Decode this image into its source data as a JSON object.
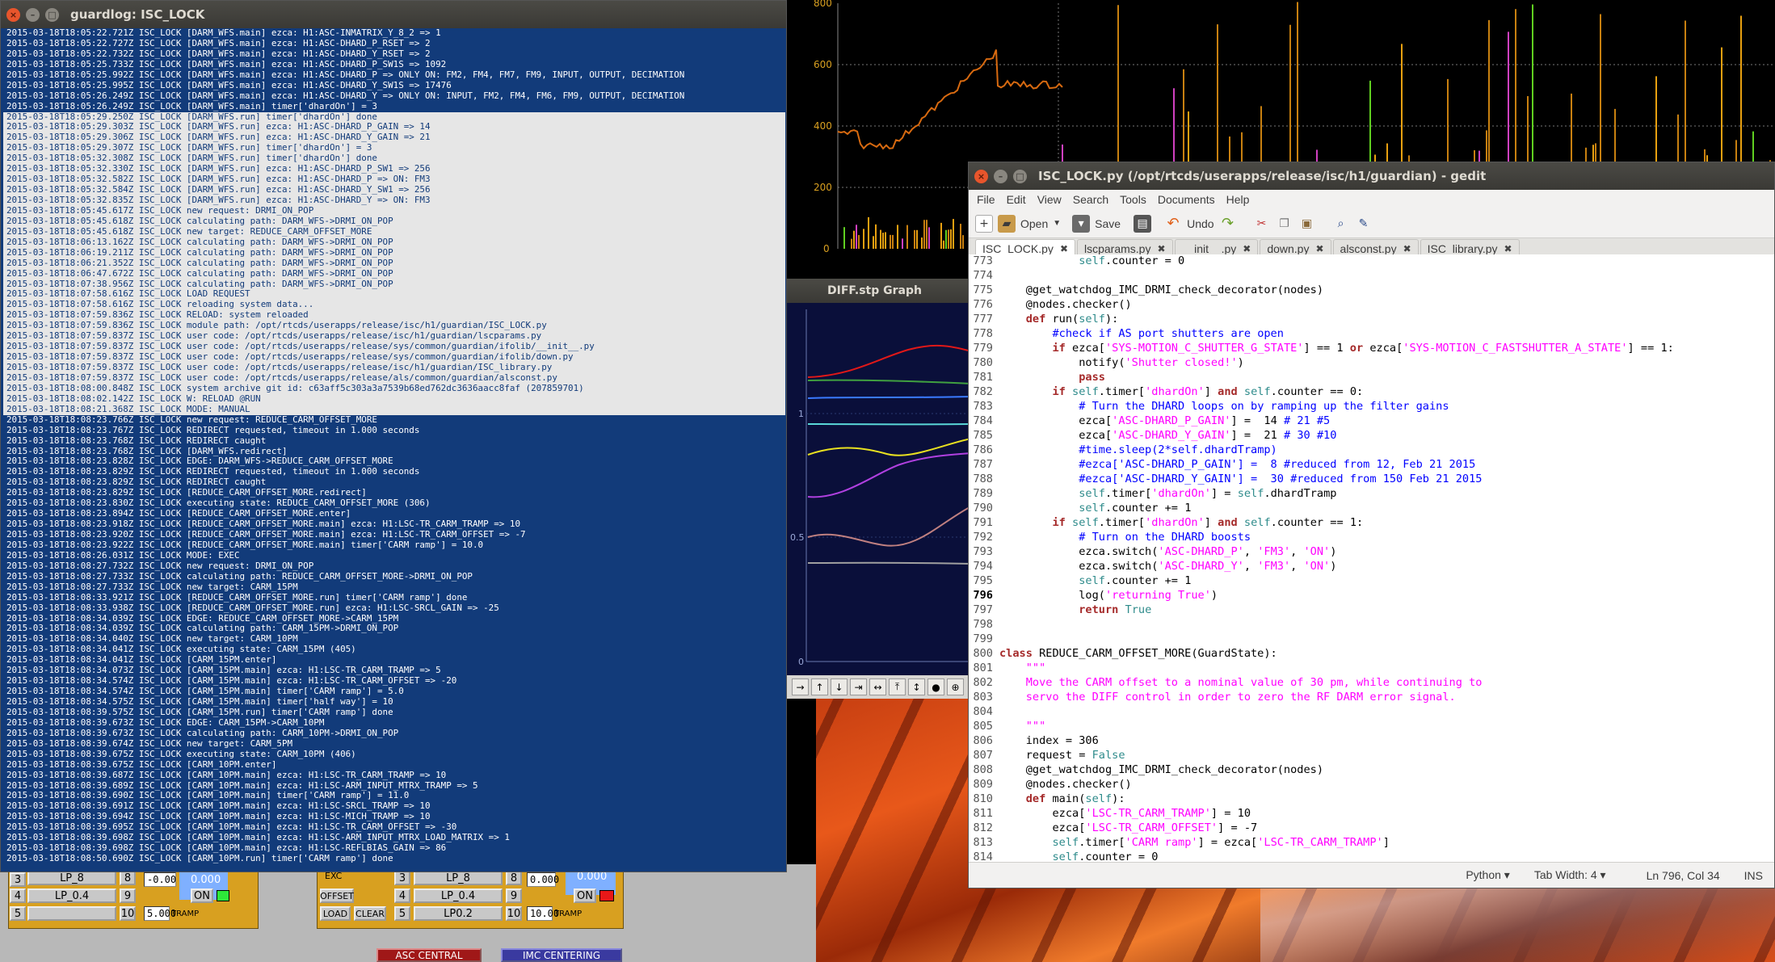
{
  "terminal": {
    "title": "guardlog: ISC_LOCK",
    "selected_from": 8,
    "selected_to": 36,
    "lines": [
      "2015-03-18T18:05:22.721Z ISC_LOCK [DARM_WFS.main] ezca: H1:ASC-INMATRIX_Y_8_2 => 1",
      "2015-03-18T18:05:22.727Z ISC_LOCK [DARM_WFS.main] ezca: H1:ASC-DHARD_P_RSET => 2",
      "2015-03-18T18:05:22.732Z ISC_LOCK [DARM_WFS.main] ezca: H1:ASC-DHARD_Y_RSET => 2",
      "2015-03-18T18:05:25.733Z ISC_LOCK [DARM_WFS.main] ezca: H1:ASC-DHARD_P_SW1S => 1092",
      "2015-03-18T18:05:25.992Z ISC_LOCK [DARM_WFS.main] ezca: H1:ASC-DHARD_P => ONLY ON: FM2, FM4, FM7, FM9, INPUT, OUTPUT, DECIMATION",
      "2015-03-18T18:05:25.995Z ISC_LOCK [DARM_WFS.main] ezca: H1:ASC-DHARD_Y_SW1S => 17476",
      "2015-03-18T18:05:26.249Z ISC_LOCK [DARM_WFS.main] ezca: H1:ASC-DHARD_Y => ONLY ON: INPUT, FM2, FM4, FM6, FM9, OUTPUT, DECIMATION",
      "2015-03-18T18:05:26.249Z ISC_LOCK [DARM_WFS.main] timer['dhardOn'] = 3",
      "2015-03-18T18:05:29.250Z ISC_LOCK [DARM_WFS.run] timer['dhardOn'] done",
      "2015-03-18T18:05:29.303Z ISC_LOCK [DARM_WFS.run] ezca: H1:ASC-DHARD_P_GAIN => 14",
      "2015-03-18T18:05:29.306Z ISC_LOCK [DARM_WFS.run] ezca: H1:ASC-DHARD_Y_GAIN => 21",
      "2015-03-18T18:05:29.307Z ISC_LOCK [DARM_WFS.run] timer['dhardOn'] = 3",
      "2015-03-18T18:05:32.308Z ISC_LOCK [DARM_WFS.run] timer['dhardOn'] done",
      "2015-03-18T18:05:32.330Z ISC_LOCK [DARM_WFS.run] ezca: H1:ASC-DHARD_P_SW1 => 256",
      "2015-03-18T18:05:32.582Z ISC_LOCK [DARM_WFS.run] ezca: H1:ASC-DHARD_P => ON: FM3",
      "2015-03-18T18:05:32.584Z ISC_LOCK [DARM_WFS.run] ezca: H1:ASC-DHARD_Y_SW1 => 256",
      "2015-03-18T18:05:32.835Z ISC_LOCK [DARM_WFS.run] ezca: H1:ASC-DHARD_Y => ON: FM3",
      "2015-03-18T18:05:45.617Z ISC_LOCK new request: DRMI_ON_POP",
      "2015-03-18T18:05:45.618Z ISC_LOCK calculating path: DARM_WFS->DRMI_ON_POP",
      "2015-03-18T18:05:45.618Z ISC_LOCK new target: REDUCE_CARM_OFFSET_MORE",
      "2015-03-18T18:06:13.162Z ISC_LOCK calculating path: DARM_WFS->DRMI_ON_POP",
      "2015-03-18T18:06:19.211Z ISC_LOCK calculating path: DARM_WFS->DRMI_ON_POP",
      "2015-03-18T18:06:21.352Z ISC_LOCK calculating path: DARM_WFS->DRMI_ON_POP",
      "2015-03-18T18:06:47.672Z ISC_LOCK calculating path: DARM_WFS->DRMI_ON_POP",
      "2015-03-18T18:07:38.956Z ISC_LOCK calculating path: DARM_WFS->DRMI_ON_POP",
      "2015-03-18T18:07:58.616Z ISC_LOCK LOAD REQUEST",
      "2015-03-18T18:07:58.616Z ISC_LOCK reloading system data...",
      "2015-03-18T18:07:59.836Z ISC_LOCK RELOAD: system reloaded",
      "2015-03-18T18:07:59.836Z ISC_LOCK module path: /opt/rtcds/userapps/release/isc/h1/guardian/ISC_LOCK.py",
      "2015-03-18T18:07:59.837Z ISC_LOCK user code: /opt/rtcds/userapps/release/isc/h1/guardian/lscparams.py",
      "2015-03-18T18:07:59.837Z ISC_LOCK user code: /opt/rtcds/userapps/release/sys/common/guardian/ifolib/__init__.py",
      "2015-03-18T18:07:59.837Z ISC_LOCK user code: /opt/rtcds/userapps/release/sys/common/guardian/ifolib/down.py",
      "2015-03-18T18:07:59.837Z ISC_LOCK user code: /opt/rtcds/userapps/release/isc/h1/guardian/ISC_library.py",
      "2015-03-18T18:07:59.837Z ISC_LOCK user code: /opt/rtcds/userapps/release/als/common/guardian/alsconst.py",
      "2015-03-18T18:08:00.848Z ISC_LOCK system archive git id: c63aff5c303a3a7539b68ed762dc3636aacc8faf (207859701)",
      "2015-03-18T18:08:02.142Z ISC_LOCK W: RELOAD @RUN",
      "2015-03-18T18:08:21.368Z ISC_LOCK MODE: MANUAL",
      "2015-03-18T18:08:23.766Z ISC_LOCK new request: REDUCE_CARM_OFFSET_MORE",
      "2015-03-18T18:08:23.767Z ISC_LOCK REDIRECT requested, timeout in 1.000 seconds",
      "2015-03-18T18:08:23.768Z ISC_LOCK REDIRECT caught",
      "2015-03-18T18:08:23.768Z ISC_LOCK [DARM_WFS.redirect]",
      "2015-03-18T18:08:23.828Z ISC_LOCK EDGE: DARM_WFS->REDUCE_CARM_OFFSET_MORE",
      "2015-03-18T18:08:23.829Z ISC_LOCK REDIRECT requested, timeout in 1.000 seconds",
      "2015-03-18T18:08:23.829Z ISC_LOCK REDIRECT caught",
      "2015-03-18T18:08:23.829Z ISC_LOCK [REDUCE_CARM_OFFSET_MORE.redirect]",
      "2015-03-18T18:08:23.830Z ISC_LOCK executing state: REDUCE_CARM_OFFSET_MORE (306)",
      "2015-03-18T18:08:23.894Z ISC_LOCK [REDUCE_CARM_OFFSET_MORE.enter]",
      "2015-03-18T18:08:23.918Z ISC_LOCK [REDUCE_CARM_OFFSET_MORE.main] ezca: H1:LSC-TR_CARM_TRAMP => 10",
      "2015-03-18T18:08:23.920Z ISC_LOCK [REDUCE_CARM_OFFSET_MORE.main] ezca: H1:LSC-TR_CARM_OFFSET => -7",
      "2015-03-18T18:08:23.922Z ISC_LOCK [REDUCE_CARM_OFFSET_MORE.main] timer['CARM ramp'] = 10.0",
      "2015-03-18T18:08:26.031Z ISC_LOCK MODE: EXEC",
      "2015-03-18T18:08:27.732Z ISC_LOCK new request: DRMI_ON_POP",
      "2015-03-18T18:08:27.733Z ISC_LOCK calculating path: REDUCE_CARM_OFFSET_MORE->DRMI_ON_POP",
      "2015-03-18T18:08:27.733Z ISC_LOCK new target: CARM_15PM",
      "2015-03-18T18:08:33.921Z ISC_LOCK [REDUCE_CARM_OFFSET_MORE.run] timer['CARM ramp'] done",
      "2015-03-18T18:08:33.938Z ISC_LOCK [REDUCE_CARM_OFFSET_MORE.run] ezca: H1:LSC-SRCL_GAIN => -25",
      "2015-03-18T18:08:34.039Z ISC_LOCK EDGE: REDUCE_CARM_OFFSET_MORE->CARM_15PM",
      "2015-03-18T18:08:34.039Z ISC_LOCK calculating path: CARM_15PM->DRMI_ON_POP",
      "2015-03-18T18:08:34.040Z ISC_LOCK new target: CARM_10PM",
      "2015-03-18T18:08:34.041Z ISC_LOCK executing state: CARM_15PM (405)",
      "2015-03-18T18:08:34.041Z ISC_LOCK [CARM_15PM.enter]",
      "2015-03-18T18:08:34.073Z ISC_LOCK [CARM_15PM.main] ezca: H1:LSC-TR_CARM_TRAMP => 5",
      "2015-03-18T18:08:34.574Z ISC_LOCK [CARM_15PM.main] ezca: H1:LSC-TR_CARM_OFFSET => -20",
      "2015-03-18T18:08:34.574Z ISC_LOCK [CARM_15PM.main] timer['CARM ramp'] = 5.0",
      "2015-03-18T18:08:34.575Z ISC_LOCK [CARM_15PM.main] timer['half way'] = 10",
      "2015-03-18T18:08:39.575Z ISC_LOCK [CARM_15PM.run] timer['CARM ramp'] done",
      "2015-03-18T18:08:39.673Z ISC_LOCK EDGE: CARM_15PM->CARM_10PM",
      "2015-03-18T18:08:39.673Z ISC_LOCK calculating path: CARM_10PM->DRMI_ON_POP",
      "2015-03-18T18:08:39.674Z ISC_LOCK new target: CARM_5PM",
      "2015-03-18T18:08:39.675Z ISC_LOCK executing state: CARM_10PM (406)",
      "2015-03-18T18:08:39.675Z ISC_LOCK [CARM_10PM.enter]",
      "2015-03-18T18:08:39.687Z ISC_LOCK [CARM_10PM.main] ezca: H1:LSC-TR_CARM_TRAMP => 10",
      "2015-03-18T18:08:39.689Z ISC_LOCK [CARM_10PM.main] ezca: H1:LSC-ARM_INPUT_MTRX_TRAMP => 5",
      "2015-03-18T18:08:39.690Z ISC_LOCK [CARM_10PM.main] timer['CARM ramp'] = 11.0",
      "2015-03-18T18:08:39.691Z ISC_LOCK [CARM_10PM.main] ezca: H1:LSC-SRCL_TRAMP => 10",
      "2015-03-18T18:08:39.694Z ISC_LOCK [CARM_10PM.main] ezca: H1:LSC-MICH_TRAMP => 10",
      "2015-03-18T18:08:39.695Z ISC_LOCK [CARM_10PM.main] ezca: H1:LSC-TR_CARM_OFFSET => -30",
      "2015-03-18T18:08:39.698Z ISC_LOCK [CARM_10PM.main] ezca: H1:LSC-ARM_INPUT_MTRX_LOAD_MATRIX => 1",
      "2015-03-18T18:08:39.698Z ISC_LOCK [CARM_10PM.main] ezca: H1:LSC-REFLBIAS_GAIN => 86",
      "2015-03-18T18:08:50.690Z ISC_LOCK [CARM_10PM.run] timer['CARM ramp'] done"
    ]
  },
  "trend": {
    "y_ticks": [
      "800",
      "600",
      "400",
      "200",
      "0"
    ]
  },
  "graph": {
    "title": "DIFF.stp Graph",
    "y_ticks": [
      "1",
      "0.5",
      "0"
    ],
    "toolbar_icons": [
      "arrow-right-icon",
      "arrow-up-icon",
      "arrow-down-icon",
      "zoom-x-icon",
      "expand-x-icon",
      "zoom-y-icon",
      "expand-y-icon",
      "record-icon",
      "more-icon"
    ]
  },
  "gedit": {
    "title": "ISC_LOCK.py (/opt/rtcds/userapps/release/isc/h1/guardian) - gedit",
    "menu": [
      "File",
      "Edit",
      "View",
      "Search",
      "Tools",
      "Documents",
      "Help"
    ],
    "toolbar": {
      "open": "Open",
      "save": "Save",
      "undo": "Undo"
    },
    "tabs": [
      "ISC_LOCK.py",
      "lscparams.py",
      "__init__.py",
      "down.py",
      "alsconst.py",
      "ISC_library.py"
    ],
    "active_tab": 0,
    "current_line": "796",
    "status": {
      "language": "Python ▾",
      "tab_width": "Tab Width: 4 ▾",
      "position": "Ln 796, Col 34",
      "mode": "INS"
    },
    "code": [
      {
        "n": "773",
        "t": "            self.counter = 0"
      },
      {
        "n": "774",
        "t": ""
      },
      {
        "n": "775",
        "t": "    @get_watchdog_IMC_DRMI_check_decorator(nodes)"
      },
      {
        "n": "776",
        "t": "    @nodes.checker()"
      },
      {
        "n": "777",
        "t": "    def run(self):"
      },
      {
        "n": "778",
        "t": "        #check if AS port shutters are open"
      },
      {
        "n": "779",
        "t": "        if ezca['SYS-MOTION_C_SHUTTER_G_STATE'] == 1 or ezca['SYS-MOTION_C_FASTSHUTTER_A_STATE'] == 1:"
      },
      {
        "n": "780",
        "t": "            notify('Shutter closed!')"
      },
      {
        "n": "781",
        "t": "            pass"
      },
      {
        "n": "782",
        "t": "        if self.timer['dhardOn'] and self.counter == 0:"
      },
      {
        "n": "783",
        "t": "            # Turn the DHARD loops on by ramping up the filter gains"
      },
      {
        "n": "784",
        "t": "            ezca['ASC-DHARD_P_GAIN'] =  14 # 21 #5"
      },
      {
        "n": "785",
        "t": "            ezca['ASC-DHARD_Y_GAIN'] =  21 # 30 #10"
      },
      {
        "n": "786",
        "t": "            #time.sleep(2*self.dhardTramp)"
      },
      {
        "n": "787",
        "t": "            #ezca['ASC-DHARD_P_GAIN'] =  8 #reduced from 12, Feb 21 2015"
      },
      {
        "n": "788",
        "t": "            #ezca['ASC-DHARD_Y_GAIN'] =  30 #reduced from 150 Feb 21 2015"
      },
      {
        "n": "789",
        "t": "            self.timer['dhardOn'] = self.dhardTramp"
      },
      {
        "n": "790",
        "t": "            self.counter += 1"
      },
      {
        "n": "791",
        "t": "        if self.timer['dhardOn'] and self.counter == 1:"
      },
      {
        "n": "792",
        "t": "            # Turn on the DHARD boosts"
      },
      {
        "n": "793",
        "t": "            ezca.switch('ASC-DHARD_P', 'FM3', 'ON')"
      },
      {
        "n": "794",
        "t": "            ezca.switch('ASC-DHARD_Y', 'FM3', 'ON')"
      },
      {
        "n": "795",
        "t": "            self.counter += 1"
      },
      {
        "n": "796",
        "t": "            log('returning True')"
      },
      {
        "n": "797",
        "t": "            return True"
      },
      {
        "n": "798",
        "t": ""
      },
      {
        "n": "799",
        "t": ""
      },
      {
        "n": "800",
        "t": "class REDUCE_CARM_OFFSET_MORE(GuardState):"
      },
      {
        "n": "801",
        "t": "    \"\"\""
      },
      {
        "n": "802",
        "t": "    Move the CARM offset to a nominal value of 30 pm, while continuing to"
      },
      {
        "n": "803",
        "t": "    servo the DIFF control in order to zero the RF DARM error signal."
      },
      {
        "n": "804",
        "t": ""
      },
      {
        "n": "805",
        "t": "    \"\"\""
      },
      {
        "n": "806",
        "t": "    index = 306"
      },
      {
        "n": "807",
        "t": "    request = False"
      },
      {
        "n": "808",
        "t": "    @get_watchdog_IMC_DRMI_check_decorator(nodes)"
      },
      {
        "n": "809",
        "t": "    @nodes.checker()"
      },
      {
        "n": "810",
        "t": "    def main(self):"
      },
      {
        "n": "811",
        "t": "        ezca['LSC-TR_CARM_TRAMP'] = 10"
      },
      {
        "n": "812",
        "t": "        ezca['LSC-TR_CARM_OFFSET'] = -7"
      },
      {
        "n": "813",
        "t": "        self.timer['CARM ramp'] = ezca['LSC-TR_CARM_TRAMP']"
      },
      {
        "n": "814",
        "t": "        self.counter = 0"
      }
    ]
  },
  "medm": {
    "left": {
      "lp8": "LP_8",
      "lp04": "LP_0.4",
      "n3": "3",
      "n8": "8",
      "n9": "9",
      "n10": "10",
      "offset": "-0.00",
      "value": "0.000",
      "on": "ON",
      "tramp_val": "5.000",
      "tramp": "TRAMP"
    },
    "right": {
      "exc": "EXC",
      "offset_btn": "OFFSET",
      "load": "LOAD",
      "clear": "CLEAR",
      "lp8": "LP_8",
      "lp04": "LP_0.4",
      "lp2": "LP0.2",
      "n3": "3",
      "n4": "4",
      "n5": "5",
      "n8": "8",
      "n9": "9",
      "n10": "10",
      "offset": "0.000",
      "value": "0.000",
      "on": "ON",
      "tramp_val": "10.00",
      "tramp": "TRAMP"
    },
    "bottom_buttons": [
      "ASC CENTRAL",
      "IMC CENTERING"
    ]
  }
}
